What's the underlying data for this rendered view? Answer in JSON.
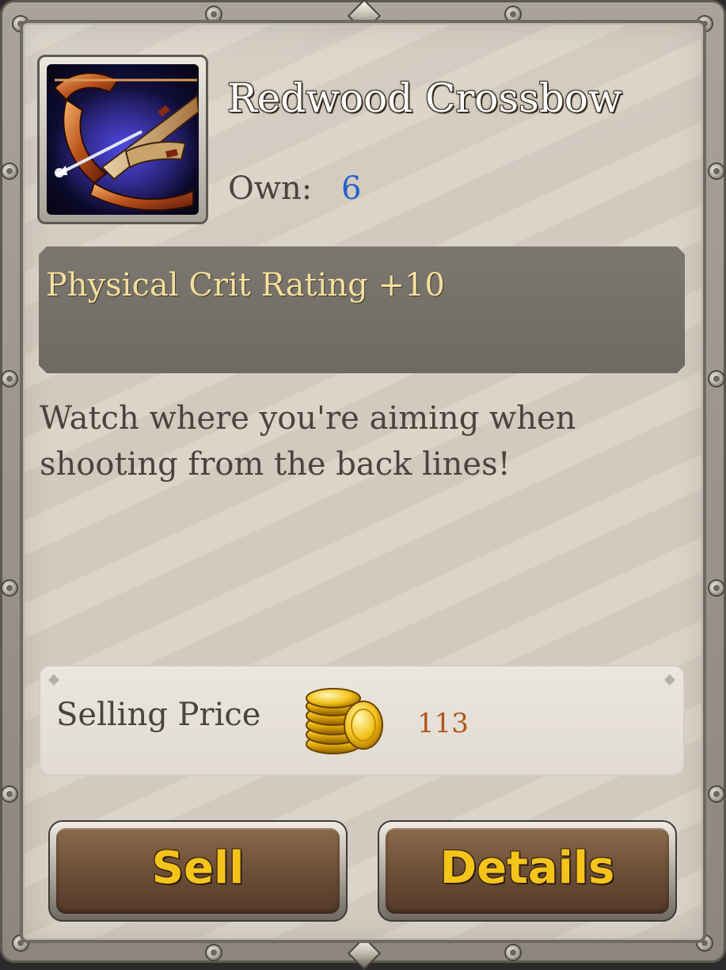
{
  "item": {
    "name": "Redwood Crossbow",
    "own_label": "Own:",
    "own_count": "6",
    "stat": "Physical Crit Rating +10",
    "description": "Watch where you're aiming when shooting from the back lines!",
    "icon": "crossbow-icon"
  },
  "price": {
    "label": "Selling Price",
    "value": "113",
    "icon": "gold-coins-icon"
  },
  "buttons": {
    "sell": "Sell",
    "details": "Details"
  },
  "colors": {
    "title": "#ffffff",
    "own_count": "#2a5fcc",
    "stat_text": "#f4df9c",
    "price_value": "#b0561b",
    "button_text": "#f5c41a"
  }
}
